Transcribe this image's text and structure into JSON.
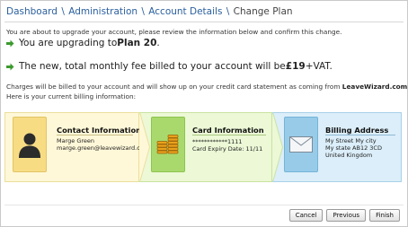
{
  "breadcrumb": {
    "items": [
      "Dashboard",
      "Administration",
      "Account Details"
    ],
    "current": "Change Plan",
    "separator": "\\"
  },
  "intro_text": "You are about to upgrade your account, please review the information below and confirm this change.",
  "upgrade": {
    "prefix": "You are upgrading to ",
    "plan": "Plan 20",
    "suffix": "."
  },
  "fee": {
    "prefix": "The new, total monthly fee billed to your account will be ",
    "amount": "£19",
    "suffix": " +VAT."
  },
  "charges": {
    "line1_prefix": "Charges will be billed to your account and will show up on your credit card statement as coming from ",
    "brand": "LeaveWizard.com",
    "line1_suffix": ".",
    "line2": "Here is your current billing information:"
  },
  "contact": {
    "title": "Contact Information",
    "name": "Marge Green",
    "email": "marge.green@leavewizard.com"
  },
  "card_info": {
    "title": "Card Information",
    "number": "************1111",
    "expiry": "Card Expiry Date: 11/11"
  },
  "billing": {
    "title": "Billing Address",
    "line1": "My Street My city",
    "line2": "My state AB12 3CD",
    "line3": "United Kingdom"
  },
  "buttons": {
    "cancel": "Cancel",
    "previous": "Previous",
    "finish": "Finish"
  },
  "icons": {
    "arrow": "green-arrow-icon",
    "contact": "person-silhouette-icon",
    "card": "coin-stack-icon",
    "address": "envelope-icon"
  },
  "colors": {
    "link": "#2a5f9e",
    "arrow_green": "#3c9a2e",
    "contact_bg": "#fff8d8",
    "card_bg": "#ecf8d6",
    "address_bg": "#dbeef9"
  }
}
